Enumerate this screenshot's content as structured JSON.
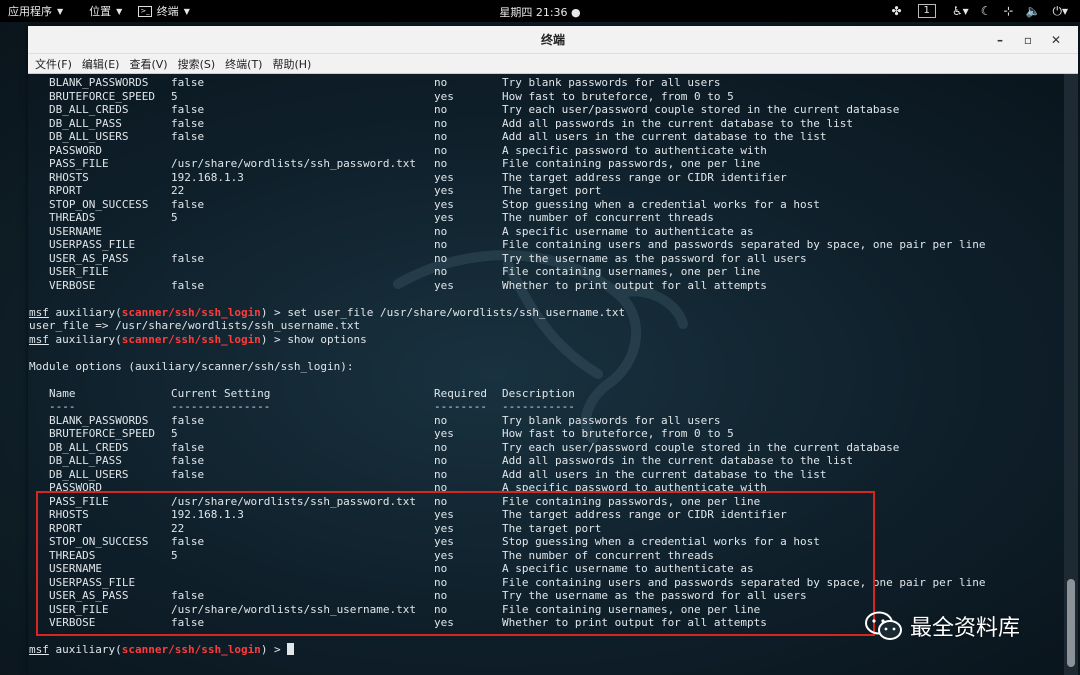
{
  "topbar": {
    "apps": "应用程序",
    "places": "位置",
    "terminal": "终端",
    "clock": "星期四 21:36",
    "workspace": "1"
  },
  "window": {
    "title": "终端",
    "menu": [
      "文件(F)",
      "编辑(E)",
      "查看(V)",
      "搜索(S)",
      "终端(T)",
      "帮助(H)"
    ]
  },
  "terminal": {
    "top_options": [
      {
        "name": "BLANK_PASSWORDS",
        "setting": "false",
        "required": "no",
        "desc": "Try blank passwords for all users"
      },
      {
        "name": "BRUTEFORCE_SPEED",
        "setting": "5",
        "required": "yes",
        "desc": "How fast to bruteforce, from 0 to 5"
      },
      {
        "name": "DB_ALL_CREDS",
        "setting": "false",
        "required": "no",
        "desc": "Try each user/password couple stored in the current database"
      },
      {
        "name": "DB_ALL_PASS",
        "setting": "false",
        "required": "no",
        "desc": "Add all passwords in the current database to the list"
      },
      {
        "name": "DB_ALL_USERS",
        "setting": "false",
        "required": "no",
        "desc": "Add all users in the current database to the list"
      },
      {
        "name": "PASSWORD",
        "setting": "",
        "required": "no",
        "desc": "A specific password to authenticate with"
      },
      {
        "name": "PASS_FILE",
        "setting": "/usr/share/wordlists/ssh_password.txt",
        "required": "no",
        "desc": "File containing passwords, one per line"
      },
      {
        "name": "RHOSTS",
        "setting": "192.168.1.3",
        "required": "yes",
        "desc": "The target address range or CIDR identifier"
      },
      {
        "name": "RPORT",
        "setting": "22",
        "required": "yes",
        "desc": "The target port"
      },
      {
        "name": "STOP_ON_SUCCESS",
        "setting": "false",
        "required": "yes",
        "desc": "Stop guessing when a credential works for a host"
      },
      {
        "name": "THREADS",
        "setting": "5",
        "required": "yes",
        "desc": "The number of concurrent threads"
      },
      {
        "name": "USERNAME",
        "setting": "",
        "required": "no",
        "desc": "A specific username to authenticate as"
      },
      {
        "name": "USERPASS_FILE",
        "setting": "",
        "required": "no",
        "desc": "File containing users and passwords separated by space, one pair per line"
      },
      {
        "name": "USER_AS_PASS",
        "setting": "false",
        "required": "no",
        "desc": "Try the username as the password for all users"
      },
      {
        "name": "USER_FILE",
        "setting": "",
        "required": "no",
        "desc": "File containing usernames, one per line"
      },
      {
        "name": "VERBOSE",
        "setting": "false",
        "required": "yes",
        "desc": "Whether to print output for all attempts"
      }
    ],
    "prompt_msf": "msf",
    "prompt_aux": " auxiliary(",
    "prompt_module": "scanner/ssh/ssh_login",
    "prompt_end": ") > ",
    "cmd1": "set user_file /usr/share/wordlists/ssh_username.txt",
    "cmd1_output": "user_file => /usr/share/wordlists/ssh_username.txt",
    "cmd2": "show options",
    "module_options_header": "Module options (auxiliary/scanner/ssh/ssh_login):",
    "headers": {
      "name": "Name",
      "setting": "Current Setting",
      "required": "Required",
      "desc": "Description"
    },
    "underlines": {
      "name": "----",
      "setting": "---------------",
      "required": "--------",
      "desc": "-----------"
    },
    "bottom_options": [
      {
        "name": "BLANK_PASSWORDS",
        "setting": "false",
        "required": "no",
        "desc": "Try blank passwords for all users"
      },
      {
        "name": "BRUTEFORCE_SPEED",
        "setting": "5",
        "required": "yes",
        "desc": "How fast to bruteforce, from 0 to 5"
      },
      {
        "name": "DB_ALL_CREDS",
        "setting": "false",
        "required": "no",
        "desc": "Try each user/password couple stored in the current database"
      },
      {
        "name": "DB_ALL_PASS",
        "setting": "false",
        "required": "no",
        "desc": "Add all passwords in the current database to the list"
      },
      {
        "name": "DB_ALL_USERS",
        "setting": "false",
        "required": "no",
        "desc": "Add all users in the current database to the list"
      },
      {
        "name": "PASSWORD",
        "setting": "",
        "required": "no",
        "desc": "A specific password to authenticate with"
      },
      {
        "name": "PASS_FILE",
        "setting": "/usr/share/wordlists/ssh_password.txt",
        "required": "no",
        "desc": "File containing passwords, one per line"
      },
      {
        "name": "RHOSTS",
        "setting": "192.168.1.3",
        "required": "yes",
        "desc": "The target address range or CIDR identifier"
      },
      {
        "name": "RPORT",
        "setting": "22",
        "required": "yes",
        "desc": "The target port"
      },
      {
        "name": "STOP_ON_SUCCESS",
        "setting": "false",
        "required": "yes",
        "desc": "Stop guessing when a credential works for a host"
      },
      {
        "name": "THREADS",
        "setting": "5",
        "required": "yes",
        "desc": "The number of concurrent threads"
      },
      {
        "name": "USERNAME",
        "setting": "",
        "required": "no",
        "desc": "A specific username to authenticate as"
      },
      {
        "name": "USERPASS_FILE",
        "setting": "",
        "required": "no",
        "desc": "File containing users and passwords separated by space, one pair per line"
      },
      {
        "name": "USER_AS_PASS",
        "setting": "false",
        "required": "no",
        "desc": "Try the username as the password for all users"
      },
      {
        "name": "USER_FILE",
        "setting": "/usr/share/wordlists/ssh_username.txt",
        "required": "no",
        "desc": "File containing usernames, one per line"
      },
      {
        "name": "VERBOSE",
        "setting": "false",
        "required": "yes",
        "desc": "Whether to print output for all attempts"
      }
    ]
  },
  "watermark": {
    "text": "最全资料库"
  },
  "colors": {
    "module_red": "#ff3b3b",
    "highlight_red": "#d8261f"
  }
}
